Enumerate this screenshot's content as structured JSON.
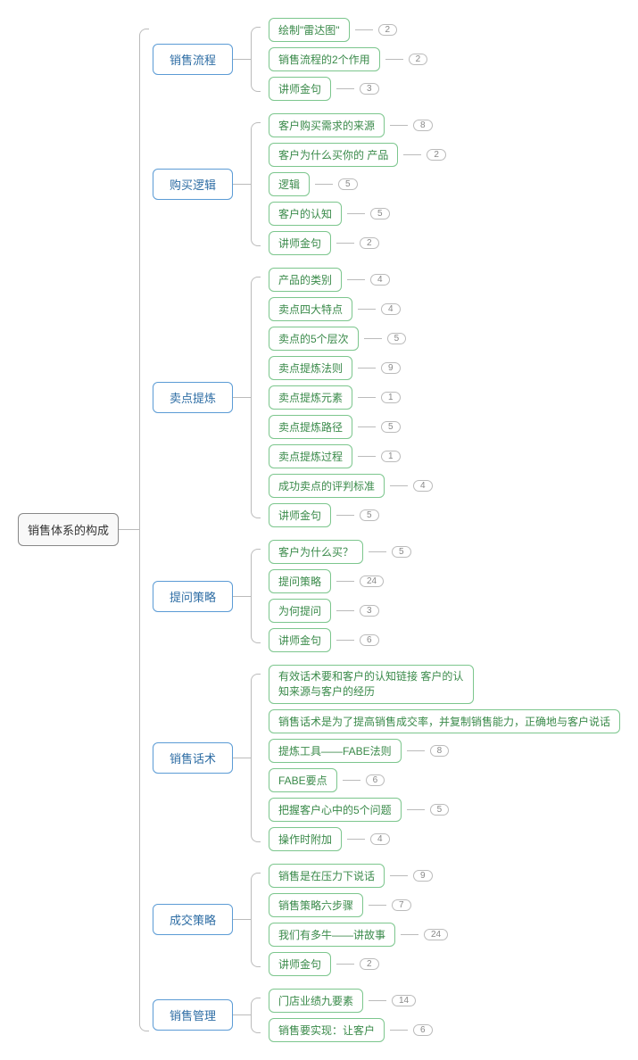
{
  "root": {
    "label": "销售体系的构成"
  },
  "branches": [
    {
      "label": "销售流程",
      "leaves": [
        {
          "label": "绘制\"雷达图\"",
          "count": 2
        },
        {
          "label": "销售流程的2个作用",
          "count": 2
        },
        {
          "label": "讲师金句",
          "count": 3
        }
      ]
    },
    {
      "label": "购买逻辑",
      "leaves": [
        {
          "label": "客户购买需求的来源",
          "count": 8
        },
        {
          "label": "客户为什么买你的 产品",
          "count": 2
        },
        {
          "label": "逻辑",
          "count": 5
        },
        {
          "label": "客户的认知",
          "count": 5
        },
        {
          "label": "讲师金句",
          "count": 2
        }
      ]
    },
    {
      "label": "卖点提炼",
      "leaves": [
        {
          "label": "产品的类别",
          "count": 4
        },
        {
          "label": "卖点四大特点",
          "count": 4
        },
        {
          "label": "卖点的5个层次",
          "count": 5
        },
        {
          "label": "卖点提炼法则",
          "count": 9
        },
        {
          "label": "卖点提炼元素",
          "count": 1
        },
        {
          "label": "卖点提炼路径",
          "count": 5
        },
        {
          "label": "卖点提炼过程",
          "count": 1
        },
        {
          "label": "成功卖点的评判标准",
          "count": 4
        },
        {
          "label": "讲师金句",
          "count": 5
        }
      ]
    },
    {
      "label": "提问策略",
      "leaves": [
        {
          "label": "客户为什么买？",
          "count": 5
        },
        {
          "label": "提问策略",
          "count": 24
        },
        {
          "label": "为何提问",
          "count": 3
        },
        {
          "label": "讲师金句",
          "count": 6
        }
      ]
    },
    {
      "label": "销售话术",
      "leaves": [
        {
          "label": "有效话术要和客户的认知链接 客户的认知来源与客户的经历",
          "multiline": true
        },
        {
          "label": "销售话术是为了提高销售成交率，并复制销售能力，正确地与客户说话"
        },
        {
          "label": "提炼工具——FABE法则",
          "count": 8
        },
        {
          "label": "FABE要点",
          "count": 6
        },
        {
          "label": "把握客户心中的5个问题",
          "count": 5
        },
        {
          "label": "操作时附加",
          "count": 4
        }
      ]
    },
    {
      "label": "成交策略",
      "leaves": [
        {
          "label": "销售是在压力下说话",
          "count": 9
        },
        {
          "label": "销售策略六步骤",
          "count": 7
        },
        {
          "label": "我们有多牛——讲故事",
          "count": 24
        },
        {
          "label": "讲师金句",
          "count": 2
        }
      ]
    },
    {
      "label": "销售管理",
      "leaves": [
        {
          "label": "门店业绩九要素",
          "count": 14
        },
        {
          "label": "销售要实现：让客户",
          "count": 6
        }
      ]
    }
  ]
}
